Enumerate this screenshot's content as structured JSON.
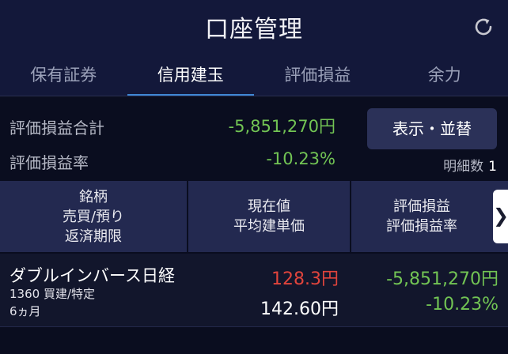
{
  "header": {
    "title": "口座管理",
    "refresh_icon": "refresh-icon"
  },
  "tabs": [
    {
      "label": "保有証券",
      "active": false
    },
    {
      "label": "信用建玉",
      "active": true
    },
    {
      "label": "評価損益",
      "active": false
    },
    {
      "label": "余力",
      "active": false
    }
  ],
  "summary": {
    "total_label": "評価損益合計",
    "total_value": "-5,851,270円",
    "rate_label": "評価損益率",
    "rate_value": "-10.23%",
    "display_button": "表示・並替",
    "detail_count_label": "明細数",
    "detail_count_value": "1"
  },
  "table": {
    "headers": {
      "col1": [
        "銘柄",
        "売買/預り",
        "返済期限"
      ],
      "col2": [
        "現在値",
        "平均建単価"
      ],
      "col3": [
        "評価損益",
        "評価損益率"
      ]
    },
    "scroll_icon": "chevron-right-icon",
    "rows": [
      {
        "name": "ダブルインバース日経",
        "code_trade": "1360 買建/特定",
        "term": "6ヵ月",
        "current_price": "128.3円",
        "avg_price": "142.60円",
        "pl": "-5,851,270円",
        "pl_rate": "-10.23%"
      }
    ]
  },
  "colors": {
    "accent": "#3f86d4",
    "loss_green": "#72c454",
    "price_red": "#e0443c",
    "background": "#0a0d1f",
    "header_bg": "#13183a"
  }
}
